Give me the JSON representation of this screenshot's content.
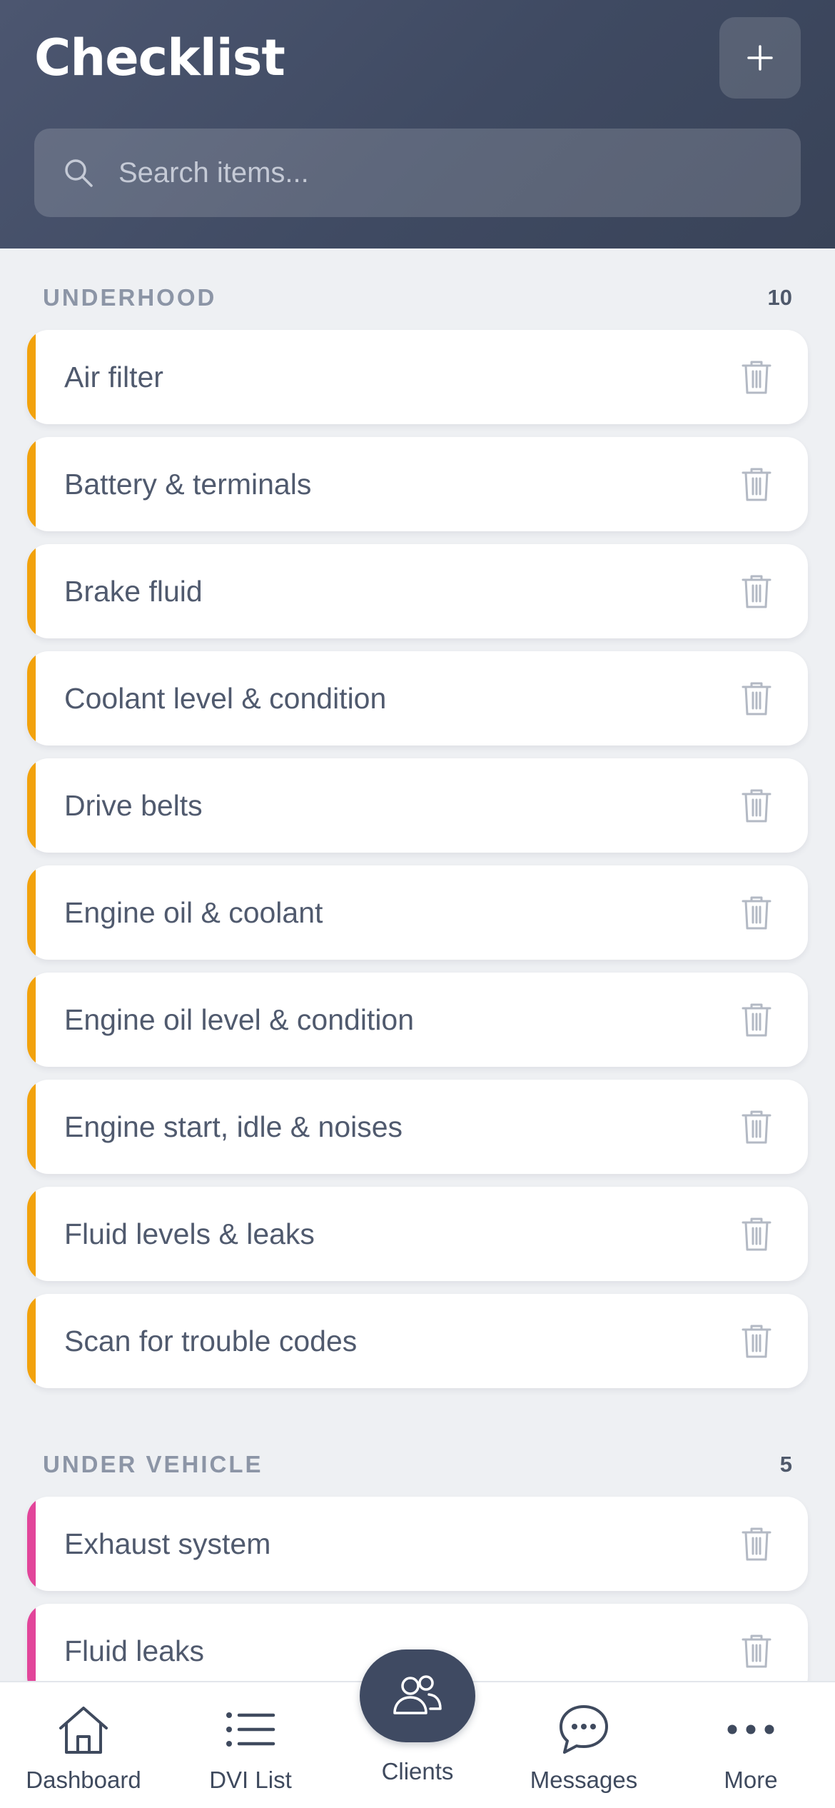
{
  "header": {
    "title": "Checklist",
    "add_icon": "plus-icon"
  },
  "search": {
    "placeholder": "Search items...",
    "value": ""
  },
  "colors": {
    "header_bg": "#3f4a62",
    "underhood_accent": "#f2a20c",
    "under_vehicle_accent": "#e2459a",
    "text": "#505a6e"
  },
  "sections": [
    {
      "title": "UNDERHOOD",
      "count": "10",
      "items": [
        "Air filter",
        "Battery & terminals",
        "Brake fluid",
        "Coolant level & condition",
        "Drive belts",
        "Engine oil & coolant",
        "Engine oil level & condition",
        "Engine start, idle & noises",
        "Fluid levels & leaks",
        "Scan for trouble codes"
      ]
    },
    {
      "title": "UNDER VEHICLE",
      "count": "5",
      "items": [
        "Exhaust system",
        "Fluid leaks"
      ]
    }
  ],
  "nav": {
    "dashboard": "Dashboard",
    "dvi_list": "DVI List",
    "clients": "Clients",
    "messages": "Messages",
    "more": "More"
  }
}
